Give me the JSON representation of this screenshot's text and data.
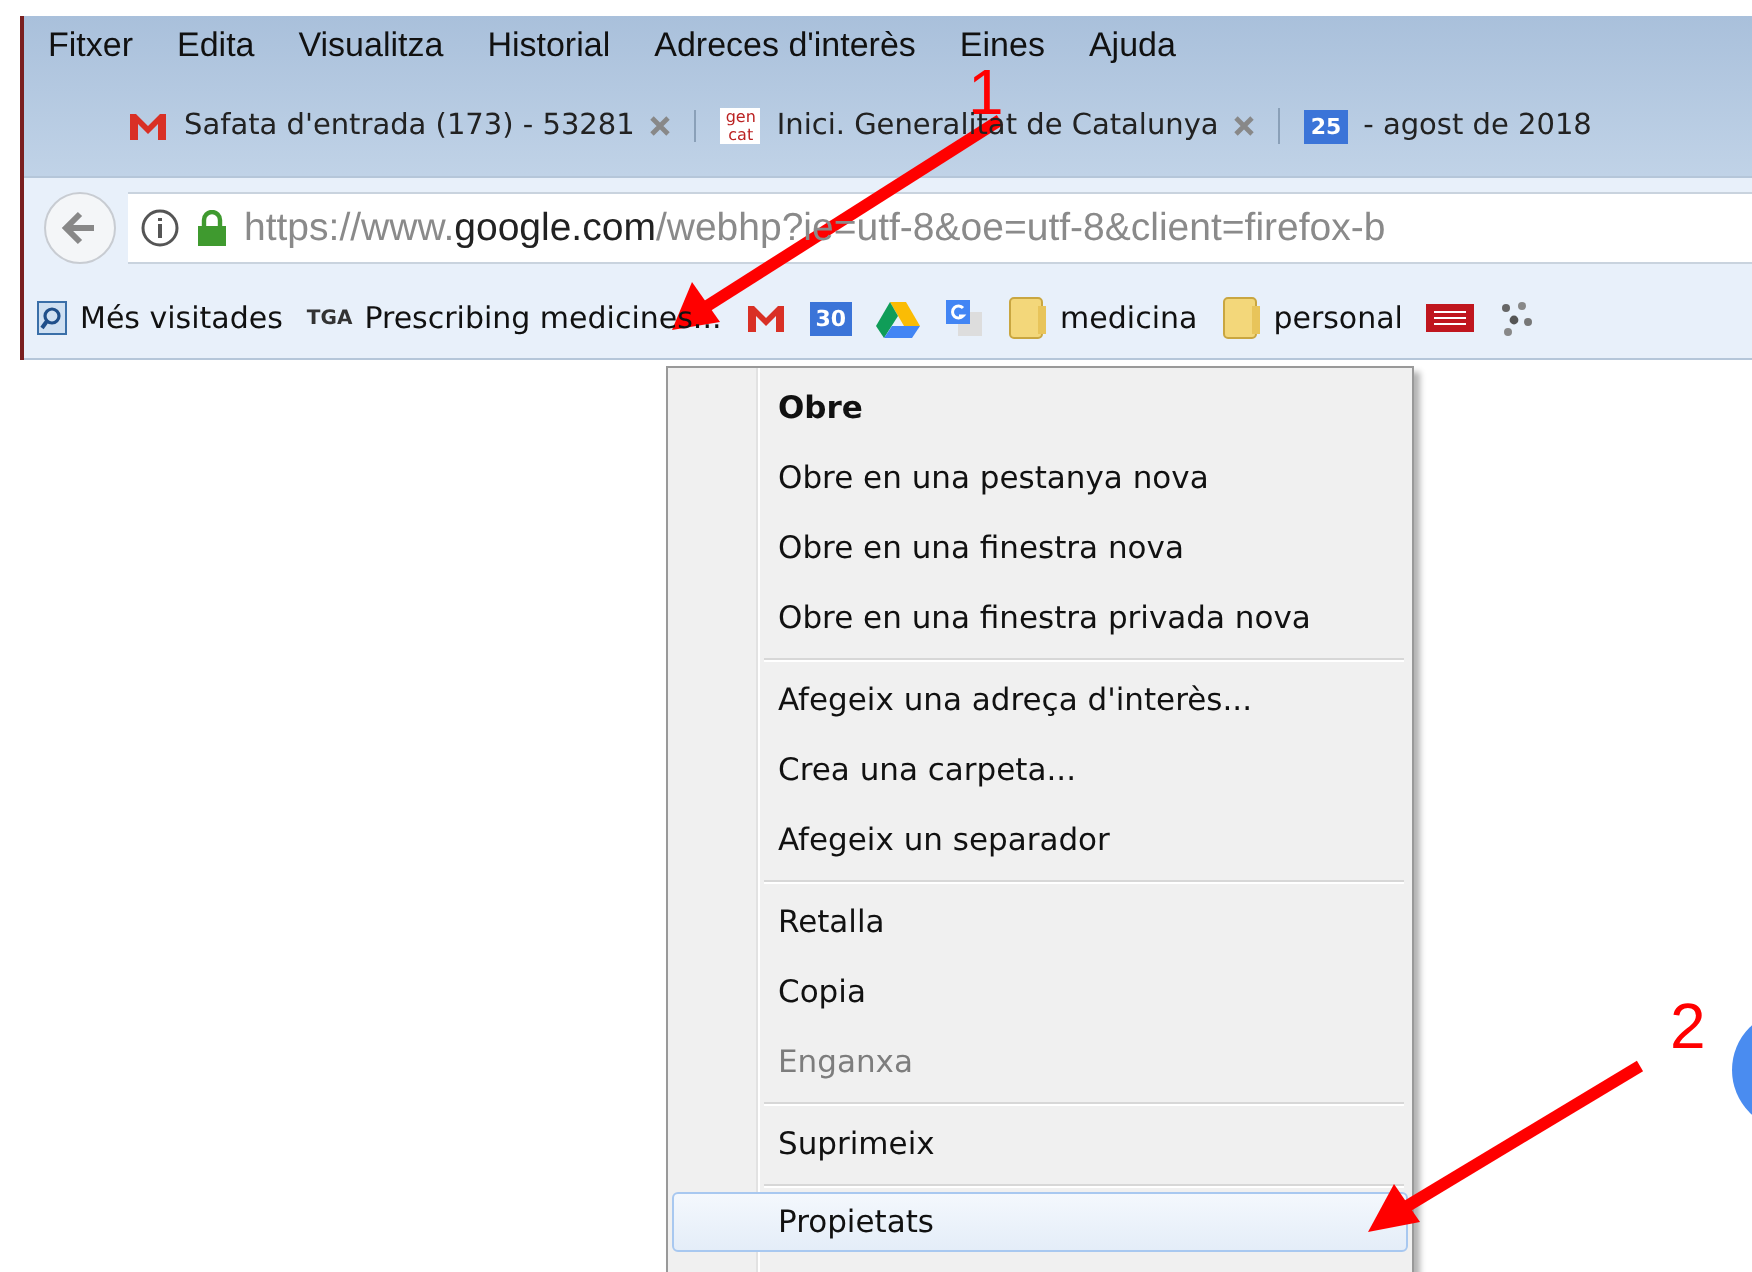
{
  "menubar": [
    "Fitxer",
    "Edita",
    "Visualitza",
    "Historial",
    "Adreces d'interès",
    "Eines",
    "Ajuda"
  ],
  "tabs": [
    {
      "kind": "gmail",
      "title": "Safata d'entrada (173) - 53281",
      "closable": true
    },
    {
      "kind": "gencat",
      "icon_text": "gen cat",
      "title": "Inici. Generalitat de Catalunya",
      "closable": true
    },
    {
      "kind": "calendar",
      "icon_text": "25",
      "title": "- agost de 2018",
      "closable": false
    }
  ],
  "url": {
    "prefix": "https://www.",
    "domain": "google.com",
    "rest": "/webhp?ie=utf-8&oe=utf-8&client=firefox-b"
  },
  "bookmarks": [
    {
      "kind": "history",
      "label": "Més visitades"
    },
    {
      "kind": "site",
      "icon_text": "TGA",
      "label": "Prescribing medicines..."
    },
    {
      "kind": "gmail"
    },
    {
      "kind": "calendar",
      "icon_text": "30"
    },
    {
      "kind": "drive"
    },
    {
      "kind": "translate"
    },
    {
      "kind": "folder",
      "label": "medicina"
    },
    {
      "kind": "folder",
      "label": "personal"
    },
    {
      "kind": "atri"
    },
    {
      "kind": "puzzle"
    }
  ],
  "context_menu": [
    {
      "kind": "item",
      "label": "Obre",
      "default": true,
      "disabled": false,
      "selected": false
    },
    {
      "kind": "item",
      "label": "Obre en una pestanya nova",
      "default": false,
      "disabled": false,
      "selected": false
    },
    {
      "kind": "item",
      "label": "Obre en una finestra nova",
      "default": false,
      "disabled": false,
      "selected": false
    },
    {
      "kind": "item",
      "label": "Obre en una finestra privada nova",
      "default": false,
      "disabled": false,
      "selected": false
    },
    {
      "kind": "separator"
    },
    {
      "kind": "item",
      "label": "Afegeix una adreça d'interès...",
      "default": false,
      "disabled": false,
      "selected": false
    },
    {
      "kind": "item",
      "label": "Crea una carpeta...",
      "default": false,
      "disabled": false,
      "selected": false
    },
    {
      "kind": "item",
      "label": "Afegeix un separador",
      "default": false,
      "disabled": false,
      "selected": false
    },
    {
      "kind": "separator"
    },
    {
      "kind": "item",
      "label": "Retalla",
      "default": false,
      "disabled": false,
      "selected": false
    },
    {
      "kind": "item",
      "label": "Copia",
      "default": false,
      "disabled": false,
      "selected": false
    },
    {
      "kind": "item",
      "label": "Enganxa",
      "default": false,
      "disabled": true,
      "selected": false
    },
    {
      "kind": "separator"
    },
    {
      "kind": "item",
      "label": "Suprimeix",
      "default": false,
      "disabled": false,
      "selected": false
    },
    {
      "kind": "separator"
    },
    {
      "kind": "item",
      "label": "Propietats",
      "default": false,
      "disabled": false,
      "selected": true
    }
  ],
  "annotations": [
    {
      "label": "1"
    },
    {
      "label": "2"
    }
  ]
}
